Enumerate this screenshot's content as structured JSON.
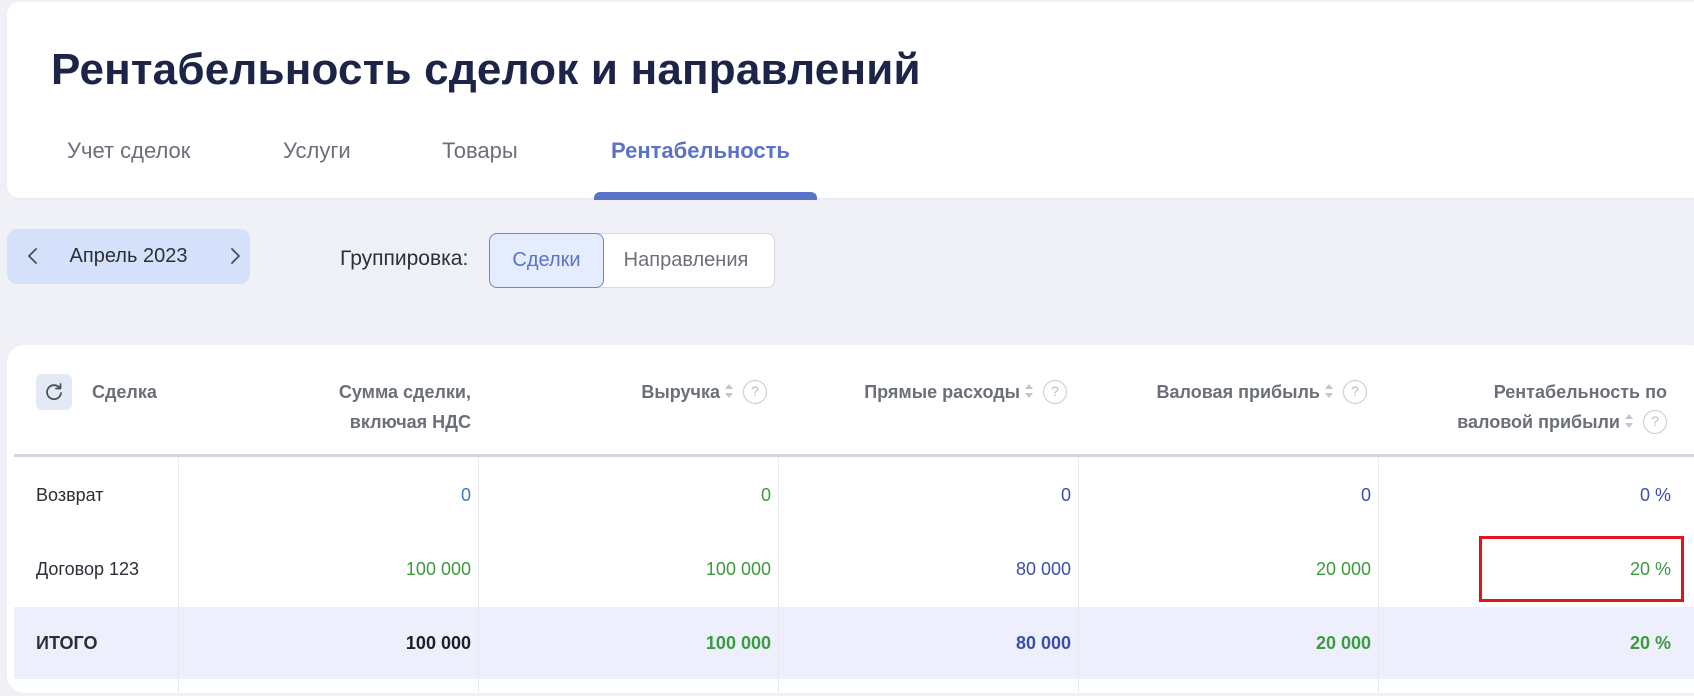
{
  "page": {
    "title": "Рентабельность сделок и направлений"
  },
  "tabs": [
    {
      "label": "Учет сделок",
      "active": false
    },
    {
      "label": "Услуги",
      "active": false
    },
    {
      "label": "Товары",
      "active": false
    },
    {
      "label": "Рентабельность",
      "active": true
    }
  ],
  "period": {
    "label": "Апрель 2023",
    "prev_icon": "chevron-left-icon",
    "next_icon": "chevron-right-icon"
  },
  "grouping": {
    "label": "Группировка:",
    "options": [
      {
        "label": "Сделки",
        "selected": true
      },
      {
        "label": "Направления",
        "selected": false
      }
    ]
  },
  "table": {
    "refresh_icon": "refresh-icon",
    "headers": {
      "deal": "Сделка",
      "deal_amount_line1": "Сумма сделки,",
      "deal_amount_line2": "включая НДС",
      "revenue": "Выручка",
      "direct_costs": "Прямые расходы",
      "gross_profit": "Валовая прибыль",
      "margin_line1": "Рентабельность по",
      "margin_line2": "валовой прибыли",
      "help_mark": "?"
    },
    "rows": [
      {
        "name": "Возврат",
        "deal_amount": "0",
        "revenue": "0",
        "direct_costs": "0",
        "gross_profit": "0",
        "margin": "0 %"
      },
      {
        "name": "Договор 123",
        "deal_amount": "100 000",
        "revenue": "100 000",
        "direct_costs": "80 000",
        "gross_profit": "20 000",
        "margin": "20 %"
      }
    ],
    "total": {
      "name": "ИТОГО",
      "deal_amount": "100 000",
      "revenue": "100 000",
      "direct_costs": "80 000",
      "gross_profit": "20 000",
      "margin": "20 %"
    }
  },
  "colors": {
    "accent": "#5a73c9",
    "title": "#1c2447",
    "value_blue": "#3d79c8",
    "value_navy": "#3a4fa8",
    "value_green": "#3b9a3e",
    "highlight_border": "#e0141b"
  }
}
